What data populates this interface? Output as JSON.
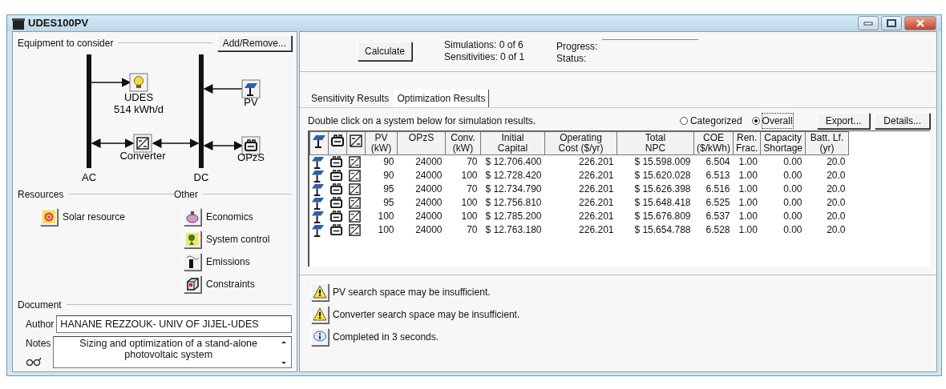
{
  "window": {
    "title": "UDES100PV"
  },
  "equipment": {
    "heading": "Equipment to consider",
    "add_remove": "Add/Remove...",
    "nodes": [
      {
        "kind": "load",
        "label": "UDES",
        "sublabel": "514 kWh/d"
      },
      {
        "kind": "pv",
        "label": "PV"
      },
      {
        "kind": "converter",
        "label": "Converter"
      },
      {
        "kind": "battery",
        "label": "OPzS"
      }
    ],
    "buses": [
      {
        "kind": "ac",
        "label": "AC"
      },
      {
        "kind": "dc",
        "label": "DC"
      }
    ]
  },
  "resources": {
    "heading": "Resources",
    "items": [
      {
        "kind": "solar",
        "label": "Solar resource"
      }
    ]
  },
  "other": {
    "heading": "Other",
    "items": [
      {
        "kind": "economics",
        "label": "Economics"
      },
      {
        "kind": "control",
        "label": "System control"
      },
      {
        "kind": "emissions",
        "label": "Emissions"
      },
      {
        "kind": "constraints",
        "label": "Constraints"
      }
    ]
  },
  "document": {
    "heading": "Document",
    "author_label": "Author",
    "author": "HANANE REZZOUK- UNIV OF JIJEL-UDES",
    "notes_label": "Notes",
    "notes": "Sizing and optimization of a stand-alone\nphotovoltaic system"
  },
  "calculate": {
    "button": "Calculate",
    "simulations_label": "Simulations:",
    "simulations": "0 of 6",
    "sensitivities_label": "Sensitivities:",
    "sensitivities": "0 of 1",
    "progress_label": "Progress:",
    "status_label": "Status:"
  },
  "tabs": [
    {
      "label": "Sensitivity Results",
      "selected": false
    },
    {
      "label": "Optimization Results",
      "selected": true
    }
  ],
  "results": {
    "hint": "Double click on a system below for simulation results.",
    "views": [
      {
        "label": "Categorized",
        "selected": false
      },
      {
        "label": "Overall",
        "selected": true
      }
    ],
    "buttons": [
      "Export...",
      "Details..."
    ],
    "table": {
      "icon_columns": [
        {
          "kind": "pv"
        },
        {
          "kind": "battery"
        },
        {
          "kind": "converter"
        }
      ],
      "columns": [
        "PV\n(kW)",
        "OPzS",
        "Conv.\n(kW)",
        "Initial\nCapital",
        "Operating\nCost ($/yr)",
        "Total\nNPC",
        "COE\n($/kWh)",
        "Ren.\nFrac.",
        "Capacity\nShortage",
        "Batt. Lf.\n(yr)"
      ],
      "rows": [
        {
          "components": [
            {
              "kind": "pv"
            },
            {
              "kind": "battery"
            },
            {
              "kind": "converter"
            }
          ],
          "cells": [
            "90",
            "24000",
            "70",
            "$ 12.706.400",
            "226.201",
            "$ 15.598.009",
            "6.504",
            "1.00",
            "0.00",
            "20.0"
          ]
        },
        {
          "components": [
            {
              "kind": "pv"
            },
            {
              "kind": "battery"
            },
            {
              "kind": "converter"
            }
          ],
          "cells": [
            "90",
            "24000",
            "100",
            "$ 12.728.420",
            "226.201",
            "$ 15.620.028",
            "6.513",
            "1.00",
            "0.00",
            "20.0"
          ]
        },
        {
          "components": [
            {
              "kind": "pv"
            },
            {
              "kind": "battery"
            },
            {
              "kind": "converter"
            }
          ],
          "cells": [
            "95",
            "24000",
            "70",
            "$ 12.734.790",
            "226.201",
            "$ 15.626.398",
            "6.516",
            "1.00",
            "0.00",
            "20.0"
          ]
        },
        {
          "components": [
            {
              "kind": "pv"
            },
            {
              "kind": "battery"
            },
            {
              "kind": "converter"
            }
          ],
          "cells": [
            "95",
            "24000",
            "100",
            "$ 12.756.810",
            "226.201",
            "$ 15.648.418",
            "6.525",
            "1.00",
            "0.00",
            "20.0"
          ]
        },
        {
          "components": [
            {
              "kind": "pv"
            },
            {
              "kind": "battery"
            },
            {
              "kind": "converter"
            }
          ],
          "cells": [
            "100",
            "24000",
            "100",
            "$ 12.785.200",
            "226.201",
            "$ 15.676.809",
            "6.537",
            "1.00",
            "0.00",
            "20.0"
          ]
        },
        {
          "components": [
            {
              "kind": "pv"
            },
            {
              "kind": "battery"
            },
            {
              "kind": "converter"
            }
          ],
          "cells": [
            "100",
            "24000",
            "70",
            "$ 12.763.180",
            "226.201",
            "$ 15.654.788",
            "6.528",
            "1.00",
            "0.00",
            "20.0"
          ]
        }
      ]
    }
  },
  "messages": [
    {
      "kind": "warning",
      "text": "PV search space may be insufficient."
    },
    {
      "kind": "warning",
      "text": "Converter search space may be insufficient."
    },
    {
      "kind": "info",
      "text": "Completed in 3 seconds."
    }
  ]
}
